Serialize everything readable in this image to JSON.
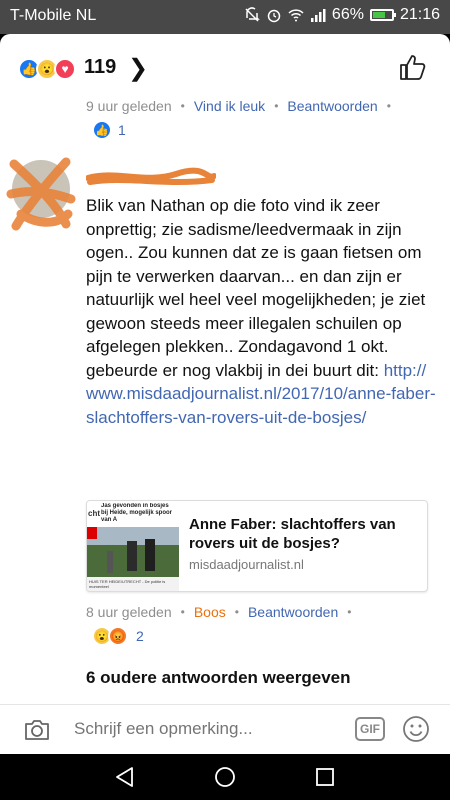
{
  "status_bar": {
    "carrier": "T-Mobile  NL",
    "battery": "66%",
    "time": "21:16",
    "battery_level": 0.66
  },
  "reactions": {
    "count": "119"
  },
  "reply_meta": {
    "time": "9 uur geleden",
    "action1": "Vind ik leuk",
    "action2": "Beantwoorden",
    "reaction_count": "1"
  },
  "comment": {
    "text": "Blik van Nathan op die foto vind ik zeer onprettig; zie sadisme/leedvermaak in zijn ogen.. Zou kunnen dat ze is gaan fietsen om pijn te verwerken daarvan... en dan zijn er natuurlijk wel heel veel mogelijkheden; je ziet gewoon steeds meer illegalen schuilen op afgelegen plekken.. Zondagavond 1 okt. gebeurde er nog vlakbij in dei buurt dit:",
    "link": "http://www.misdaadjournalist.nl/2017/10/anne-faber-slachtoffers-van-rovers-uit-de-bosjes/"
  },
  "preview": {
    "title": "Anne Faber: slachtoffers van rovers uit de bosjes?",
    "domain": "misdaadjournalist.nl",
    "thumb_headline": "Jas gevonden in bosjes bij Heide, mogelijk spoor van A",
    "thumb_prefix": "cht",
    "thumb_caption": "HUIS TER HEIDE/UTRECHT - De politie is momenteel"
  },
  "comment_meta": {
    "time": "8 uur geleden",
    "action1": "Boos",
    "action2": "Beantwoorden",
    "reaction_count": "2"
  },
  "older_replies": "6 oudere antwoorden weergeven",
  "composer": {
    "placeholder": "Schrijf een opmerking...",
    "gif": "GIF"
  },
  "colors": {
    "link": "#4267b2",
    "angry": "#e9710f",
    "like": "#1877f2",
    "scribble": "#e8833a"
  }
}
